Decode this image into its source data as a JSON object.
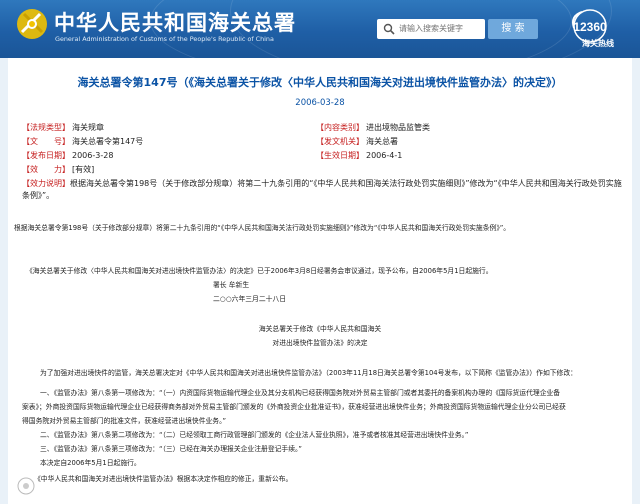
{
  "header": {
    "site_title": "中华人民共和国海关总署",
    "site_subtitle": "General Administration of Customs of the People's Republic of China",
    "search_placeholder": "请输入搜索关键字",
    "search_button": "搜 索",
    "hotline_label": "海关热线"
  },
  "document": {
    "title": "海关总署令第147号（《海关总署关于修改〈中华人民共和国海关对进出境快件监管办法〉的决定》）",
    "date": "2006-03-28",
    "meta": {
      "law_type_key": "【法规类型】",
      "law_type_val": "海关规章",
      "content_cat_key": "【内容类别】",
      "content_cat_val": "进出境物品监管类",
      "doc_no_key": "【文　　号】",
      "doc_no_val": "海关总署令第147号",
      "issuer_key": "【发文机关】",
      "issuer_val": "海关总署",
      "issue_date_key": "【发布日期】",
      "issue_date_val": "2006-3-28",
      "effective_date_key": "【生效日期】",
      "effective_date_val": "2006-4-1",
      "validity_key": "【效　　力】",
      "validity_val": "[有效]",
      "effect_note_key": "【效力说明】",
      "effect_note_val": "根据海关总署令第198号（关于修改部分规章）将第二十九条引用的“《中华人民共和国海关法行政处罚实施细则》”修改为“《中华人民共和国海关行政处罚实施条例》”。"
    },
    "body": {
      "p1": "根据海关总署令第198号（关于修改部分规章）将第二十九条引用的“《中华人民共和国海关法行政处罚实施细则》”修改为“《中华人民共和国海关行政处罚实施条例》”。",
      "p2": "《海关总署关于修改〈中华人民共和国海关对进出境快件监管办法〉的决定》已于2006年3月8日经署务会审议通过，现予公布，自2006年5月1日起施行。",
      "signer": "署长 牟新生",
      "sign_date": "二○○六年三月二十八日",
      "heading1": "海关总署关于修改《中华人民共和国海关",
      "heading2": "对进出境快件监管办法》的决定",
      "p3": "为了加强对进出境快件的监管，海关总署决定对《中华人民共和国海关对进出境快件监管办法》（2003年11月18日海关总署令第104号发布，以下简称《监管办法》）作如下修改：",
      "p4a": "一、《监管办法》第八条第一项修改为：“（一）内资国际货物运输代理企业及其分支机构已经获得国务院对外贸易主管部门或者其委托的备案机构办理的《国际货运代理企业备",
      "p4b": "案表》；外商投资国际货物运输代理企业已经获得商务部对外贸易主管部门颁发的《外商投资企业批准证书》，获准经营进出境快件业务；外商投资国际货物运输代理企业分公司已经获",
      "p4c": "得国务院对外贸易主管部门的批准文件，获准经营进出境快件业务。”",
      "p5": "二、《监管办法》第八条第二项修改为：“（二）已经领取工商行政管理部门颁发的《企业法人营业执照》，准予或者核准其经营进出境快件业务。”",
      "p6": "三、《监管办法》第八条第三项修改为：“（三）已经在海关办理报关企业注册登记手续。”",
      "p7": "本决定自2006年5月1日起施行。",
      "p8": "《中华人民共和国海关对进出境快件监管办法》根据本决定作相应的修正，重新公布。"
    }
  },
  "colors": {
    "header_blue": "#1f5fa6",
    "title_blue": "#0b53a5",
    "meta_key_red": "#c62020",
    "search_button_blue": "#6fa8dc"
  },
  "icons": [
    "customs-emblem-icon",
    "search-icon",
    "hotline-12360-icon"
  ]
}
